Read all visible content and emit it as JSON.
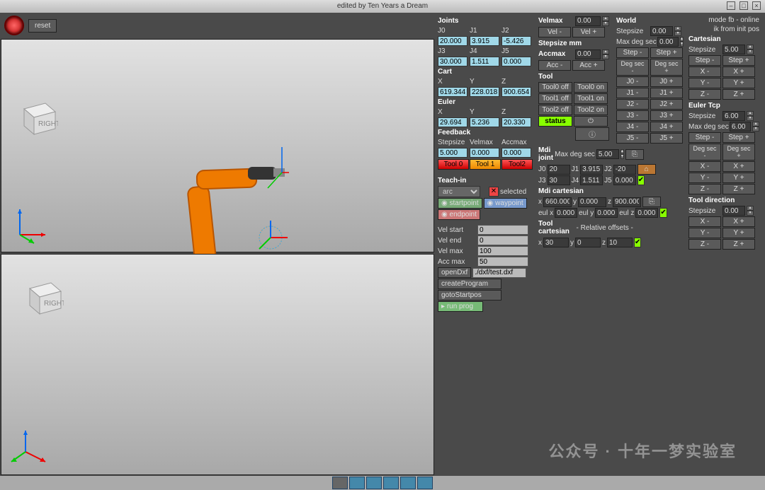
{
  "title": "edited by Ten Years a Dream",
  "reset": "reset",
  "joints_hdr": "Joints",
  "j_labels": [
    "J0",
    "J1",
    "J2",
    "J3",
    "J4",
    "J5"
  ],
  "joints": [
    "20.000",
    "3.915",
    "-5.426",
    "30.000",
    "1.511",
    "0.000"
  ],
  "cart_hdr": "Cart",
  "xyz": [
    "X",
    "Y",
    "Z"
  ],
  "cart": [
    "619.344",
    "228.018",
    "900.654"
  ],
  "euler_hdr": "Euler",
  "euler": [
    "29.694",
    "5.236",
    "20.330"
  ],
  "feedback_hdr": "Feedback",
  "fb_labels": [
    "Stepsize",
    "Velmax",
    "Accmax"
  ],
  "feedback": [
    "5.000",
    "0.000",
    "0.000"
  ],
  "tool_tabs": [
    "Tool 0",
    "Tool 1",
    "Tool2"
  ],
  "teachin_hdr": "Teach-in",
  "teach_mode": "arc",
  "selected": "selected",
  "startpoint": "startpoint",
  "waypoint": "waypoint",
  "endpoint": "endpoint",
  "vel_start_l": "Vel start",
  "vel_start": "0",
  "vel_end_l": "Vel end",
  "vel_end": "0",
  "vel_max_l": "Vel max",
  "vel_max": "100",
  "acc_max_l": "Acc max",
  "acc_max": "50",
  "openDxf": "openDxf",
  "dxf_path": "./dxf/test.dxf",
  "createProgram": "createProgram",
  "gotoStartpos": "gotoStartpos",
  "runprog": "run prog",
  "velmax_hdr": "Velmax",
  "velmax_val": "0.00",
  "velminus": "Vel -",
  "velplus": "Vel +",
  "stepsize_mm_hdr": "Stepsize mm",
  "accmax_hdr": "Accmax",
  "accmax_val": "0.00",
  "accminus": "Acc -",
  "accplus": "Acc +",
  "tool_hdr": "Tool",
  "tool_off": [
    "Tool0 off",
    "Tool1 off",
    "Tool2 off"
  ],
  "tool_on": [
    "Tool0 on",
    "Tool1 on",
    "Tool2 on"
  ],
  "status": "status",
  "world_hdr": "World",
  "stepsize_l": "Stepsize",
  "stepsize_v": "0.00",
  "maxdeg_l": "Max deg sec",
  "maxdeg_v": "0.00",
  "mode_fb": "mode fb - online",
  "ik_init": "ik from init pos",
  "stepminus": "Step -",
  "stepplus": "Step +",
  "degsecm": "Deg sec -",
  "degsecp": "Deg sec +",
  "jog_j": [
    [
      "J0 -",
      "J0 +"
    ],
    [
      "J1 -",
      "J1 +"
    ],
    [
      "J2 -",
      "J2 +"
    ],
    [
      "J3 -",
      "J3 +"
    ],
    [
      "J4 -",
      "J4 +"
    ],
    [
      "J5 -",
      "J5 +"
    ]
  ],
  "cartesian_hdr": "Cartesian",
  "cart_step": "5.00",
  "xm": "X -",
  "xp": "X +",
  "ym": "Y -",
  "yp": "Y +",
  "zm": "Z -",
  "zp": "Z +",
  "eulertcp_hdr": "Euler Tcp",
  "euler_step": "6.00",
  "euler_maxdeg": "6.00",
  "mdi_joint_hdr": "Mdi joint",
  "mdi_maxdeg": "5.00",
  "mdi_j": [
    "20",
    "3.915",
    "-20",
    "30",
    "1.511",
    "0.000"
  ],
  "mdi_cart_hdr": "Mdi cartesian",
  "mdi_xyz": [
    "660.000",
    "0.000",
    "900.000"
  ],
  "mdi_eul_l": [
    "eul x",
    "eul y",
    "eul z"
  ],
  "mdi_eul": [
    "0.000",
    "0.000",
    "0.000"
  ],
  "tool_cart_hdr": "Tool cartesian",
  "rel_off": "- Relative offsets -",
  "tool_xyz": [
    "30",
    "0",
    "10"
  ],
  "tooldir_hdr": "Tool direction",
  "tooldir_step": "0.00",
  "cube_right": "RIGHT",
  "watermark": "公众号 · 十年一梦实验室"
}
